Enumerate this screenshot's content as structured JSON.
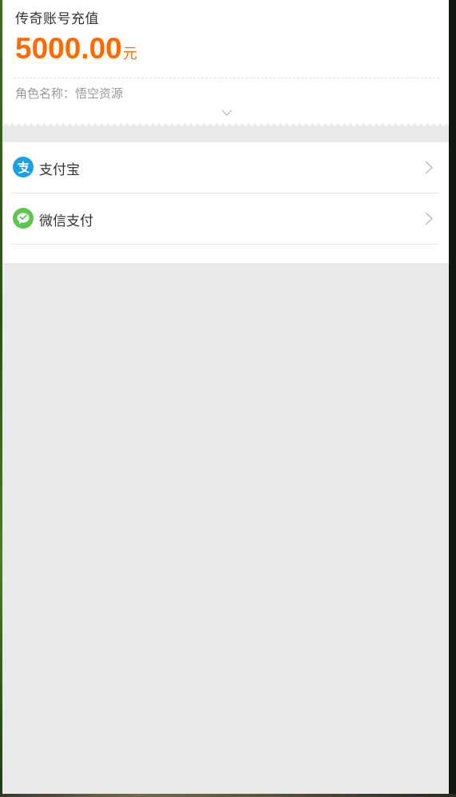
{
  "order": {
    "title": "传奇账号充值",
    "amount": "5000.00",
    "currency_unit": "元",
    "role_label": "角色名称：",
    "role_name": "悟空资源",
    "expand_icon": "chevron-down-icon"
  },
  "payment_methods": [
    {
      "label": "支付宝",
      "icon": "alipay-icon",
      "color": "#1aa0e6"
    },
    {
      "label": "微信支付",
      "icon": "wechat-pay-icon",
      "color": "#5dc64e"
    }
  ],
  "colors": {
    "accent": "#ff6a00",
    "background": "#e8e9eb",
    "card": "#ffffff"
  }
}
